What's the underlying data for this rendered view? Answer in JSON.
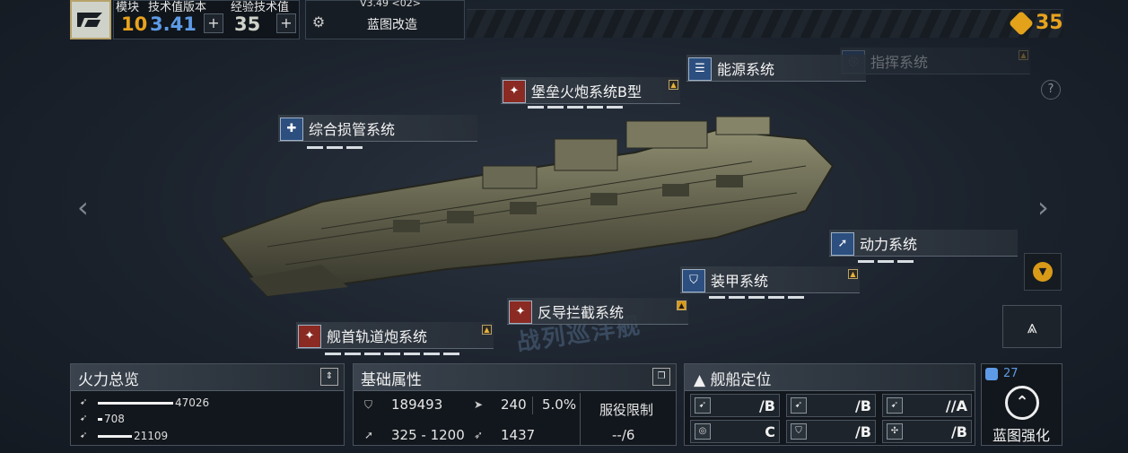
{
  "header": {
    "module_label": "模块",
    "tech_version_label": "技术值版本",
    "exp_tech_label": "经验技术值",
    "module_value": "10",
    "tech_version_value": "3.41",
    "exp_tech_value": "35",
    "version": "V3.49 <02>",
    "blueprint_mod_label": "蓝图改造",
    "currency_value": "35",
    "colors": {
      "accent": "#e8a21e",
      "blue": "#5e9be6"
    }
  },
  "systems": {
    "command": {
      "label": "指挥系统"
    },
    "energy": {
      "label": "能源系统"
    },
    "fortress": {
      "label": "堡垒火炮系统B型"
    },
    "damage_control": {
      "label": "综合损管系统"
    },
    "power": {
      "label": "动力系统"
    },
    "armor": {
      "label": "装甲系统"
    },
    "anti_intercept": {
      "label": "反导拦截系统"
    },
    "bow_rail": {
      "label": "舰首轨道炮系统",
      "badge": "M"
    }
  },
  "watermark": "战列巡洋舰",
  "firepower": {
    "title": "火力总览",
    "rows": [
      {
        "value": "47026",
        "fraction": 1.0
      },
      {
        "value": "708",
        "fraction": 0.06
      },
      {
        "value": "21109",
        "fraction": 0.45
      }
    ]
  },
  "base_attrs": {
    "title": "基础属性",
    "hp": "189493",
    "speed": "240",
    "percent": "5.0%",
    "range": "325 - 1200",
    "other": "1437",
    "service_limit_label": "服役限制",
    "service_limit_value": "--/6"
  },
  "ship_role": {
    "title": "舰船定位",
    "cells": [
      {
        "grade": "/B",
        "icon": "anti-ship-icon"
      },
      {
        "grade": "/B",
        "icon": "anti-air-icon"
      },
      {
        "grade": "//A",
        "icon": "siege-icon"
      },
      {
        "grade": "C",
        "icon": "target-icon"
      },
      {
        "grade": "/B",
        "icon": "shield-icon"
      },
      {
        "grade": "/B",
        "icon": "support-icon"
      }
    ]
  },
  "enhance": {
    "count": "27",
    "label": "蓝图强化"
  }
}
